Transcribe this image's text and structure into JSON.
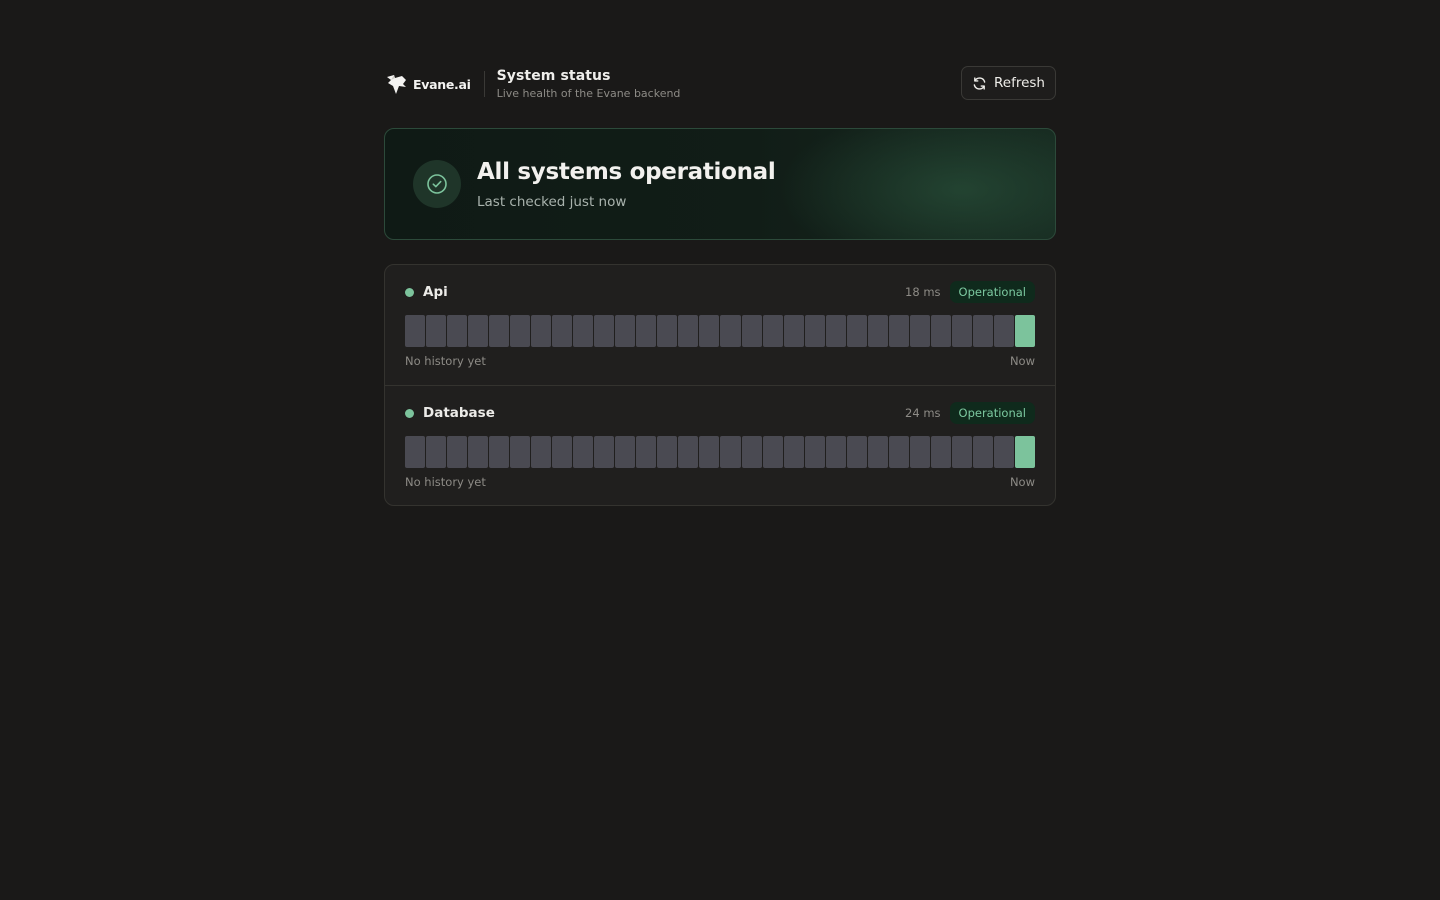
{
  "header": {
    "brand_name": "Evane.ai",
    "logo_icon": "evane-bird-icon",
    "title": "System status",
    "subtitle": "Live health of the Evane backend",
    "refresh_label": "Refresh",
    "refresh_icon": "refresh-icon"
  },
  "banner": {
    "icon": "check-circle-icon",
    "title": "All systems operational",
    "subtitle": "Last checked just now",
    "accent": "#7cc39c"
  },
  "services": [
    {
      "name": "Api",
      "latency": "18 ms",
      "status": "Operational",
      "history_label": "No history yet",
      "now_label": "Now",
      "history": [
        "none",
        "none",
        "none",
        "none",
        "none",
        "none",
        "none",
        "none",
        "none",
        "none",
        "none",
        "none",
        "none",
        "none",
        "none",
        "none",
        "none",
        "none",
        "none",
        "none",
        "none",
        "none",
        "none",
        "none",
        "none",
        "none",
        "none",
        "none",
        "none",
        "ok"
      ]
    },
    {
      "name": "Database",
      "latency": "24 ms",
      "status": "Operational",
      "history_label": "No history yet",
      "now_label": "Now",
      "history": [
        "none",
        "none",
        "none",
        "none",
        "none",
        "none",
        "none",
        "none",
        "none",
        "none",
        "none",
        "none",
        "none",
        "none",
        "none",
        "none",
        "none",
        "none",
        "none",
        "none",
        "none",
        "none",
        "none",
        "none",
        "none",
        "none",
        "none",
        "none",
        "none",
        "ok"
      ]
    }
  ],
  "colors": {
    "background": "#1a1918",
    "operational": "#7cc39c",
    "no_data": "#4a4a52"
  }
}
